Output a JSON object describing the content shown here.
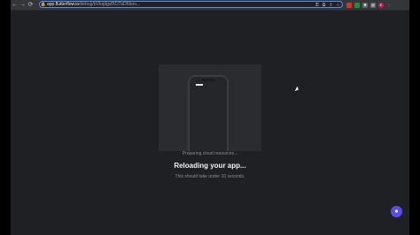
{
  "browser": {
    "url_host": "app.flutterflow.io",
    "url_path": "/debug/bVkqdgsfXU7aD6boo...",
    "nav": {
      "back": "←",
      "forward": "→",
      "reload": "⟳"
    },
    "extensions": [
      {
        "name": "ext-red",
        "glyph": "",
        "color": "#d93025"
      },
      {
        "name": "ext-green",
        "glyph": "",
        "color": "#1e8e3e"
      },
      {
        "name": "ext-puzzle",
        "glyph": "✱",
        "color": "#5f6368"
      },
      {
        "name": "ext-sidebar",
        "glyph": "▤",
        "color": "#5f6368"
      },
      {
        "name": "profile-avatar",
        "glyph": "E",
        "color": "#c2185b"
      },
      {
        "name": "menu",
        "glyph": "⋮",
        "color": "#35363a"
      }
    ]
  },
  "loading": {
    "status": "Preparing cloud resources...",
    "title": "Reloading your app...",
    "subtitle": "This should take under 10 seconds."
  },
  "chat": {
    "icon": "chat-bubble-icon"
  },
  "colors": {
    "accent": "#5b4de8",
    "background": "#1c1d20"
  }
}
